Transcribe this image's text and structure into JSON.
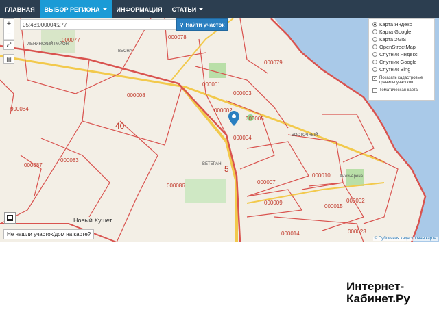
{
  "nav": {
    "items": [
      {
        "label": "ГЛАВНАЯ"
      },
      {
        "label": "ВЫБОР РЕГИОНА"
      },
      {
        "label": "ИНФОРМАЦИЯ"
      },
      {
        "label": "СТАТЬИ"
      }
    ]
  },
  "search": {
    "value": "05:48:000004:277",
    "button_label": "Найти участок"
  },
  "layers": {
    "options": [
      {
        "label": "Карта Яндекс",
        "selected": true
      },
      {
        "label": "Карта Google",
        "selected": false
      },
      {
        "label": "Карта 2GIS",
        "selected": false
      },
      {
        "label": "OpenStreetMap",
        "selected": false
      },
      {
        "label": "Спутник Яндекс",
        "selected": false
      },
      {
        "label": "Спутник Google",
        "selected": false
      },
      {
        "label": "Спутник Bing",
        "selected": false
      }
    ],
    "cadastral_label": "Показать кадастровые границы участков",
    "thematic_label": "Тематическая карта"
  },
  "map": {
    "parcels": [
      "000077",
      "000078",
      "000079",
      "000001",
      "000003",
      "000002",
      "000005",
      "000004",
      "000008",
      "000084",
      "000086",
      "000007",
      "000009",
      "000010",
      "000014",
      "000015",
      "000023",
      "000002",
      "000083",
      "000087"
    ],
    "districts": [
      "40",
      "5"
    ],
    "places": [
      "ЛЕНИНСКИЙ РАЙОН",
      "ВЕСНА",
      "ВЕТЕРАН",
      "Новый Хушет",
      "Анжи-Арена",
      "ВОСТОЧНЫЙ"
    ],
    "attribution": "© Публичная кадастровая карта"
  },
  "not_found_label": "Не нашли участок/дом на карте?",
  "watermark": {
    "line1": "Интернет-",
    "line2": "Кабинет.Ру"
  },
  "colors": {
    "navbar": "#2c3e50",
    "active": "#1b9bd6",
    "search_button": "#2a7fc0",
    "parcel_border": "#d9534f"
  }
}
